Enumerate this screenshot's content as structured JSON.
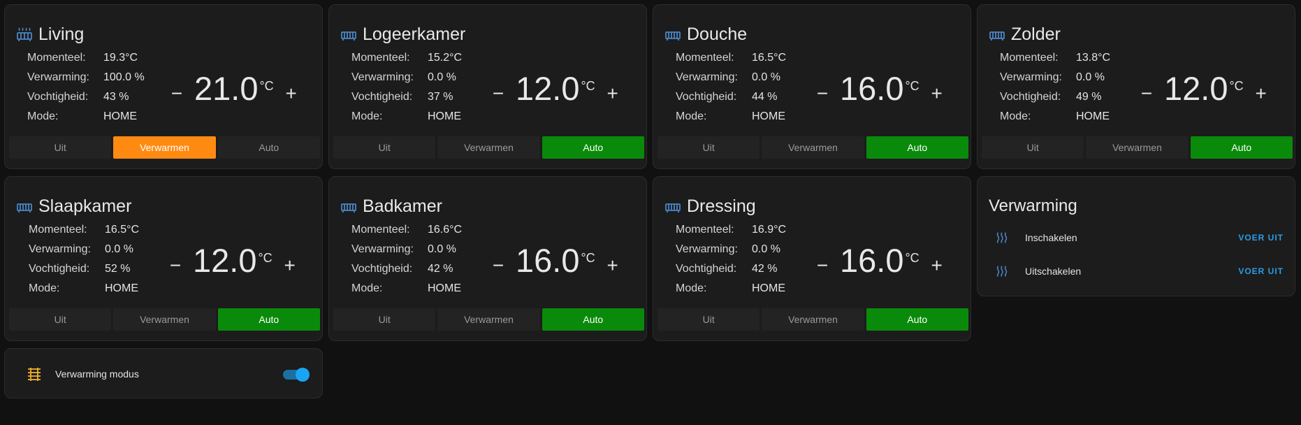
{
  "colors": {
    "background": "#111111",
    "card": "#1c1c1c",
    "auto_active": "#0a8a0a",
    "heat_active": "#ff8a11",
    "icon_blue": "#4a86c5",
    "accent": "#2a9de8",
    "toggle_icon": "#f0b429"
  },
  "labels": {
    "current": "Momenteel:",
    "heating": "Verwarming:",
    "humidity": "Vochtigheid:",
    "mode": "Mode:",
    "unit": "°C",
    "minus": "−",
    "plus": "+",
    "mode_off": "Uit",
    "mode_heat": "Verwarmen",
    "mode_auto": "Auto"
  },
  "thermostats": [
    {
      "name": "Living",
      "icon": "radiator-heating-icon",
      "current": "19.3°C",
      "heating": "100.0 %",
      "humidity": "43 %",
      "mode": "HOME",
      "setpoint": "21.0",
      "active": "heat"
    },
    {
      "name": "Logeerkamer",
      "icon": "radiator-icon",
      "current": "15.2°C",
      "heating": "0.0 %",
      "humidity": "37 %",
      "mode": "HOME",
      "setpoint": "12.0",
      "active": "auto"
    },
    {
      "name": "Douche",
      "icon": "radiator-icon",
      "current": "16.5°C",
      "heating": "0.0 %",
      "humidity": "44 %",
      "mode": "HOME",
      "setpoint": "16.0",
      "active": "auto"
    },
    {
      "name": "Zolder",
      "icon": "radiator-icon",
      "current": "13.8°C",
      "heating": "0.0 %",
      "humidity": "49 %",
      "mode": "HOME",
      "setpoint": "12.0",
      "active": "auto"
    },
    {
      "name": "Slaapkamer",
      "icon": "radiator-icon",
      "current": "16.5°C",
      "heating": "0.0 %",
      "humidity": "52 %",
      "mode": "HOME",
      "setpoint": "12.0",
      "active": "auto"
    },
    {
      "name": "Badkamer",
      "icon": "radiator-icon",
      "current": "16.6°C",
      "heating": "0.0 %",
      "humidity": "42 %",
      "mode": "HOME",
      "setpoint": "16.0",
      "active": "auto"
    },
    {
      "name": "Dressing",
      "icon": "radiator-icon",
      "current": "16.9°C",
      "heating": "0.0 %",
      "humidity": "42 %",
      "mode": "HOME",
      "setpoint": "16.0",
      "active": "auto"
    }
  ],
  "verwarming": {
    "title": "Verwarming",
    "scripts": [
      {
        "label": "Inschakelen",
        "icon": "heat-wave-icon",
        "button": "VOER UIT"
      },
      {
        "label": "Uitschakelen",
        "icon": "heat-wave-icon",
        "button": "VOER UIT"
      }
    ]
  },
  "toggle": {
    "label": "Verwarming modus",
    "icon": "heating-coil-icon",
    "state": "on"
  }
}
